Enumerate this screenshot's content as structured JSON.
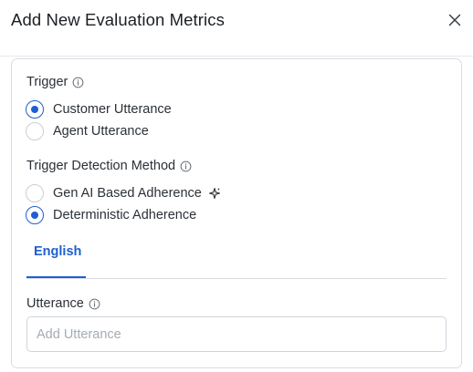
{
  "dialog": {
    "title": "Add New Evaluation Metrics"
  },
  "trigger": {
    "label": "Trigger",
    "options": [
      {
        "label": "Customer Utterance",
        "checked": true
      },
      {
        "label": "Agent Utterance",
        "checked": false
      }
    ]
  },
  "detection": {
    "label": "Trigger Detection Method",
    "options": [
      {
        "label": "Gen AI Based Adherence",
        "checked": false,
        "icon": "sparkle-icon"
      },
      {
        "label": "Deterministic Adherence",
        "checked": true
      }
    ]
  },
  "tabs": [
    {
      "label": "English",
      "active": true
    }
  ],
  "utterance": {
    "label": "Utterance",
    "placeholder": "Add Utterance",
    "value": ""
  },
  "colors": {
    "accent": "#1f5fd1",
    "border": "#d9dde3",
    "text": "#2b3038",
    "placeholder": "#a4abb4"
  }
}
